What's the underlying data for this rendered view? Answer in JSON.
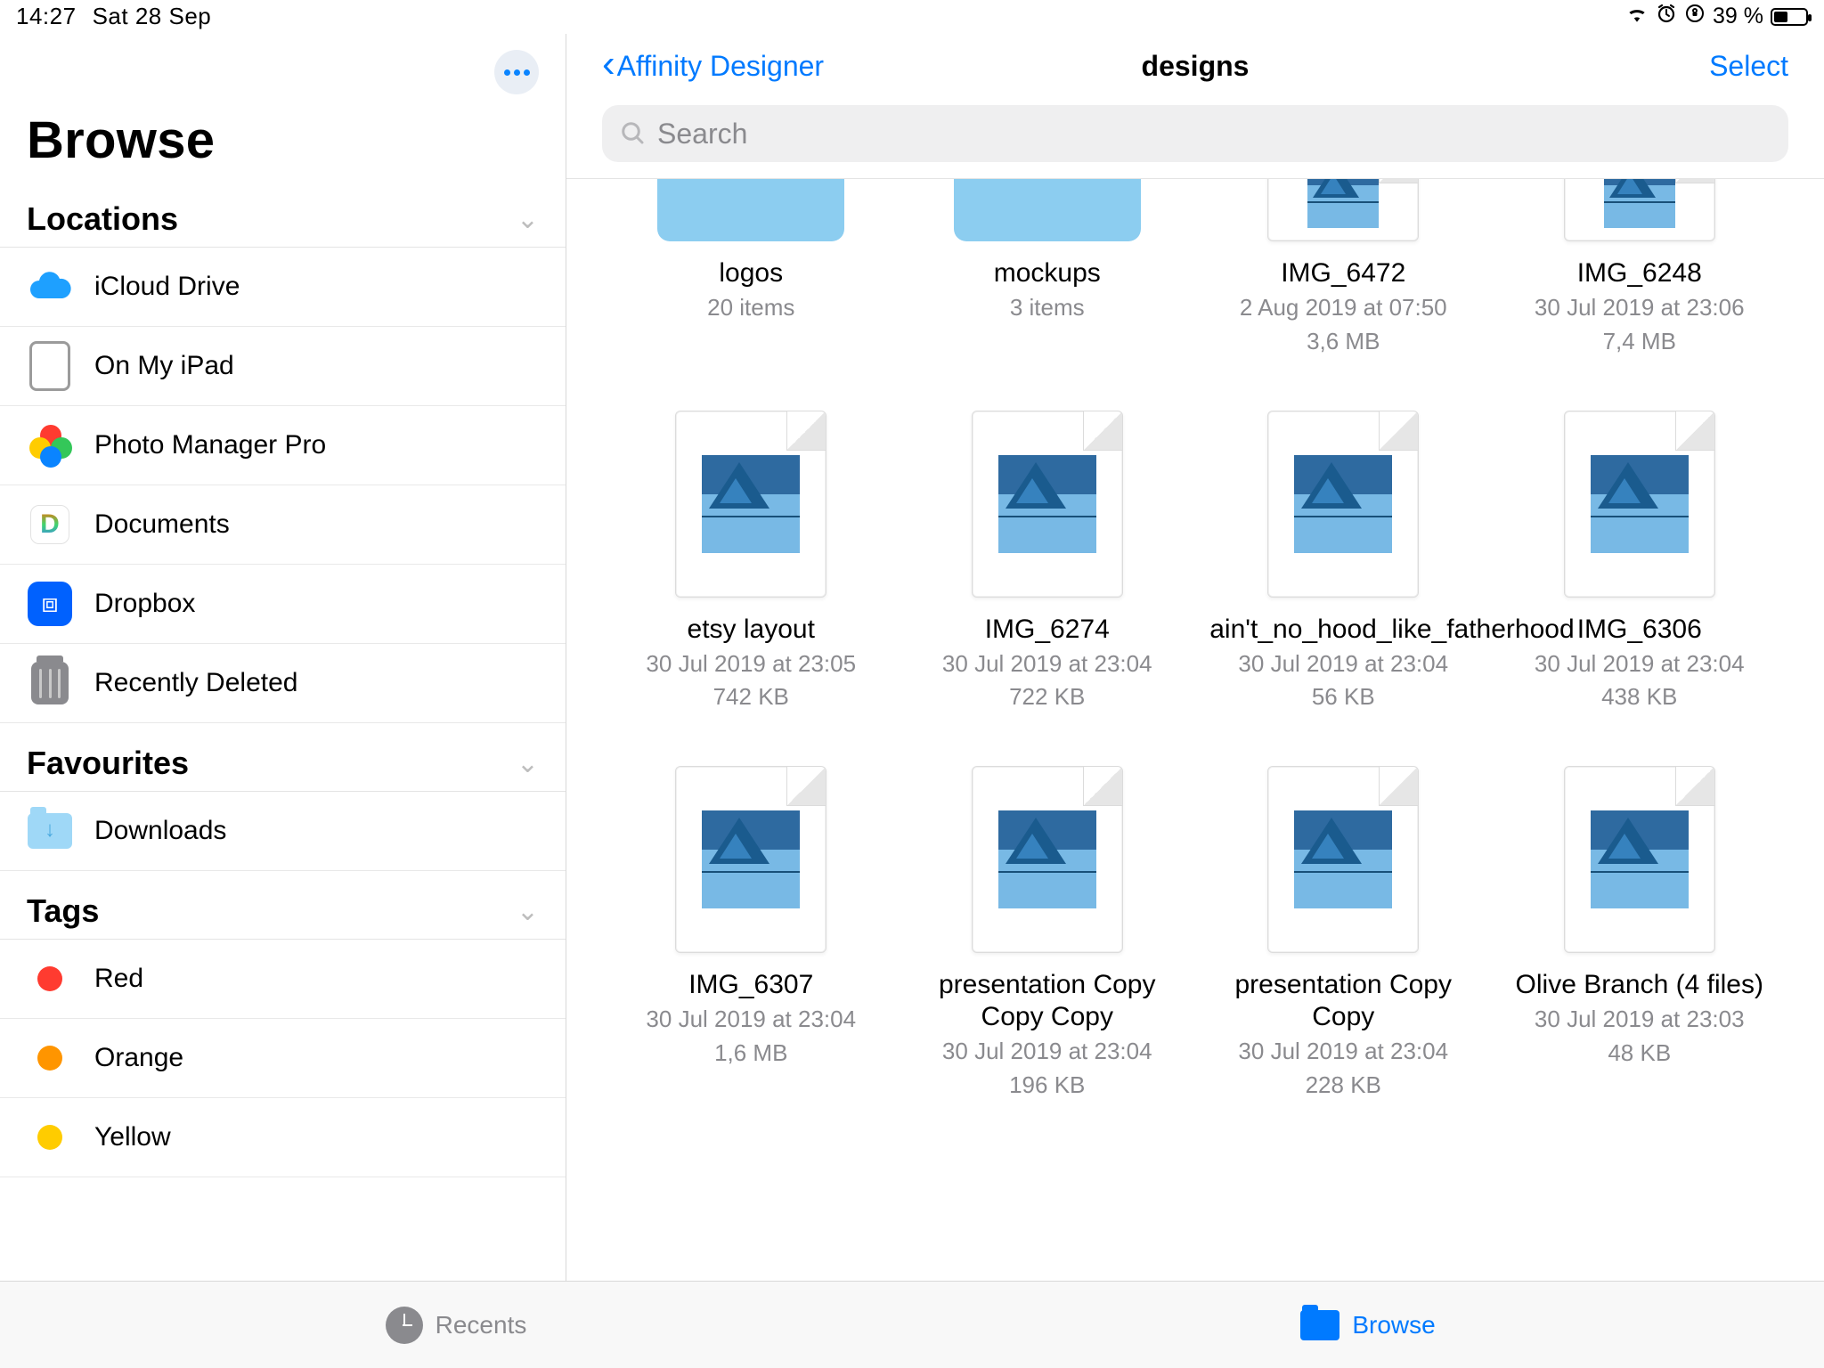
{
  "status": {
    "time": "14:27",
    "date": "Sat 28 Sep",
    "battery_pct": "39 %"
  },
  "sidebar": {
    "browse_title": "Browse",
    "locations_title": "Locations",
    "favourites_title": "Favourites",
    "tags_title": "Tags",
    "locations": [
      {
        "label": "iCloud Drive"
      },
      {
        "label": "On My iPad"
      },
      {
        "label": "Photo Manager Pro"
      },
      {
        "label": "Documents"
      },
      {
        "label": "Dropbox"
      },
      {
        "label": "Recently Deleted"
      }
    ],
    "favourites": [
      {
        "label": "Downloads"
      }
    ],
    "tags": [
      {
        "label": "Red",
        "color": "#ff3b30"
      },
      {
        "label": "Orange",
        "color": "#ff9500"
      },
      {
        "label": "Yellow",
        "color": "#ffcc00"
      }
    ]
  },
  "nav": {
    "back_label": "Affinity Designer",
    "title": "designs",
    "select_label": "Select"
  },
  "search": {
    "placeholder": "Search"
  },
  "files": [
    {
      "name": "logos",
      "meta1": "20 items",
      "meta2": "",
      "type": "folder"
    },
    {
      "name": "mockups",
      "meta1": "3 items",
      "meta2": "",
      "type": "folder"
    },
    {
      "name": "IMG_6472",
      "meta1": "2 Aug 2019 at 07:50",
      "meta2": "3,6 MB",
      "type": "doc-short"
    },
    {
      "name": "IMG_6248",
      "meta1": "30 Jul 2019 at 23:06",
      "meta2": "7,4 MB",
      "type": "doc-short"
    },
    {
      "name": "etsy layout",
      "meta1": "30 Jul 2019 at 23:05",
      "meta2": "742 KB",
      "type": "doc"
    },
    {
      "name": "IMG_6274",
      "meta1": "30 Jul 2019 at 23:04",
      "meta2": "722 KB",
      "type": "doc"
    },
    {
      "name": "ain't_no_hood_like_fatherhood",
      "meta1": "30 Jul 2019 at 23:04",
      "meta2": "56 KB",
      "type": "doc"
    },
    {
      "name": "IMG_6306",
      "meta1": "30 Jul 2019 at 23:04",
      "meta2": "438 KB",
      "type": "doc"
    },
    {
      "name": "IMG_6307",
      "meta1": "30 Jul 2019 at 23:04",
      "meta2": "1,6 MB",
      "type": "doc"
    },
    {
      "name": "presentation Copy Copy Copy",
      "meta1": "30 Jul 2019 at 23:04",
      "meta2": "196 KB",
      "type": "doc"
    },
    {
      "name": "presentation Copy Copy",
      "meta1": "30 Jul 2019 at 23:04",
      "meta2": "228 KB",
      "type": "doc"
    },
    {
      "name": "Olive Branch (4 files)",
      "meta1": "30 Jul 2019 at 23:03",
      "meta2": "48 KB",
      "type": "doc"
    }
  ],
  "bottom": {
    "recents": "Recents",
    "browse": "Browse"
  }
}
